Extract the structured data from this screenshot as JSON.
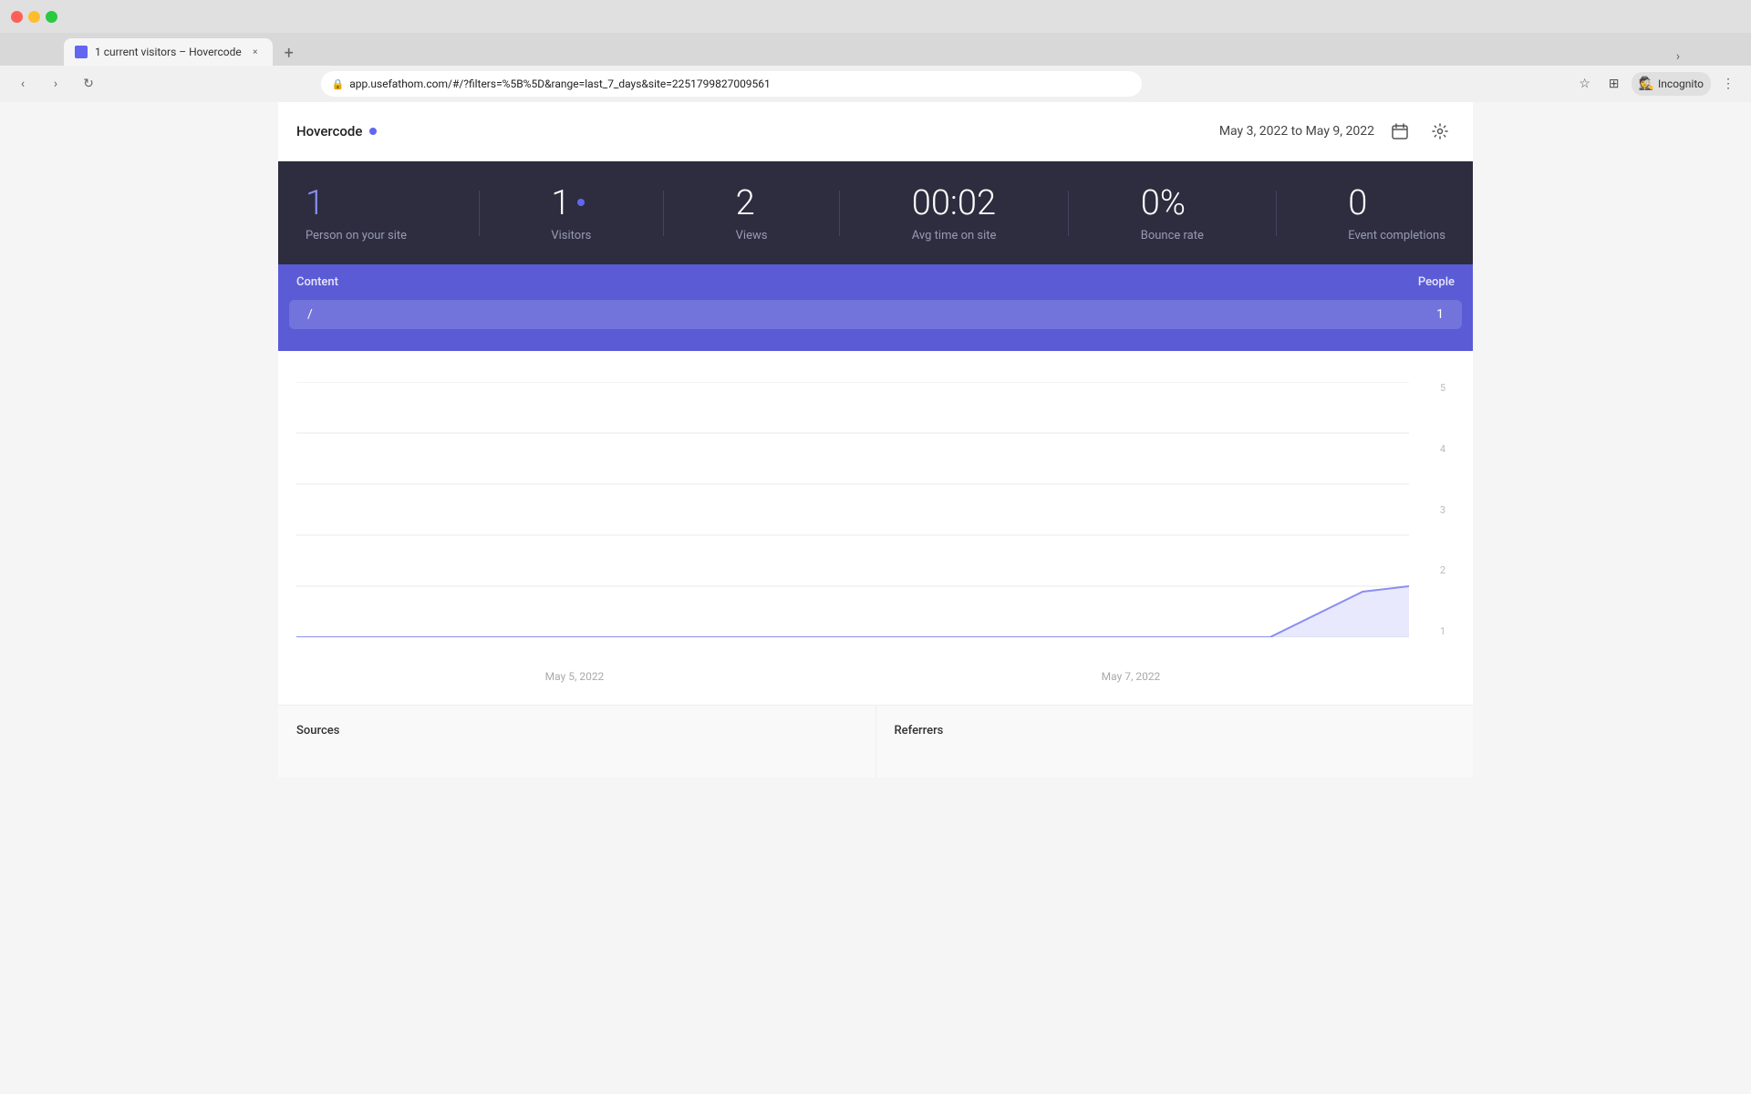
{
  "browser": {
    "tab_title": "1 current visitors – Hovercode",
    "tab_close": "×",
    "tab_new": "+",
    "url": "app.usefathom.com/#/?filters=%5B%5D&range=last_7_days&site=2251799827009561",
    "nav_back": "‹",
    "nav_forward": "›",
    "nav_refresh": "↻",
    "incognito_label": "Incognito",
    "bookmark_icon": "☆",
    "extension_icon": "⊞",
    "menu_icon": "⋮",
    "scroll_indicator": "›"
  },
  "topbar": {
    "site_name": "Hovercode",
    "date_range": "May 3, 2022 to May 9, 2022"
  },
  "stats": [
    {
      "id": "person_on_site",
      "value": "1",
      "label": "Person on your site",
      "accent": true,
      "has_dot": true
    },
    {
      "id": "visitors",
      "value": "1",
      "label": "Visitors",
      "accent": false,
      "has_dot": true
    },
    {
      "id": "views",
      "value": "2",
      "label": "Views",
      "accent": false,
      "has_dot": false
    },
    {
      "id": "avg_time",
      "value": "00:02",
      "label": "Avg time on site",
      "accent": false,
      "has_dot": false
    },
    {
      "id": "bounce_rate",
      "value": "0%",
      "label": "Bounce rate",
      "accent": false,
      "has_dot": false
    },
    {
      "id": "event_completions",
      "value": "0",
      "label": "Event completions",
      "accent": false,
      "has_dot": false
    }
  ],
  "content_table": {
    "col_content": "Content",
    "col_people": "People",
    "rows": [
      {
        "path": "/",
        "count": "1"
      }
    ]
  },
  "chart": {
    "y_labels": [
      "5",
      "4",
      "3",
      "2",
      "1"
    ],
    "x_labels": [
      "May 5, 2022",
      "May 7, 2022"
    ],
    "line_color": "#8b8ff0",
    "fill_color": "rgba(139,143,240,0.2)"
  },
  "bottom_panels": [
    {
      "id": "sources",
      "title": "Sources"
    },
    {
      "id": "referrers",
      "title": "Referrers"
    }
  ]
}
